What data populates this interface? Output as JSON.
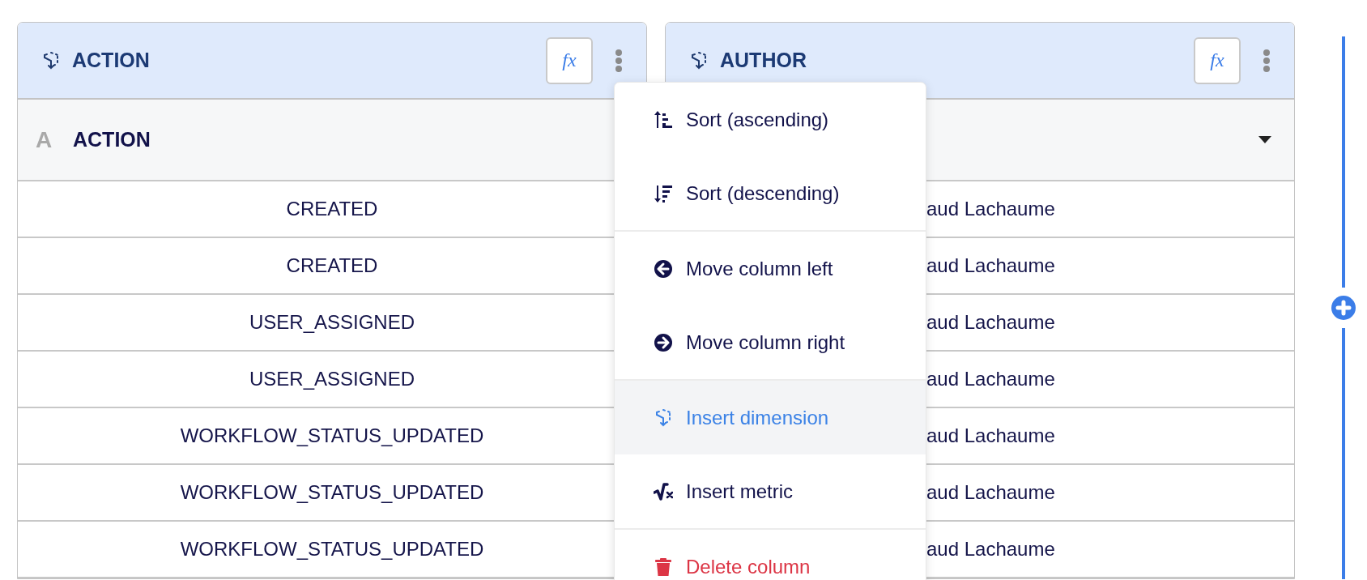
{
  "columns": [
    {
      "header": "ACTION",
      "formula_button": "fx",
      "subheader": {
        "type_glyph": "A",
        "label": "ACTION"
      },
      "rows": [
        "CREATED",
        "CREATED",
        "USER_ASSIGNED",
        "USER_ASSIGNED",
        "WORKFLOW_STATUS_UPDATED",
        "WORKFLOW_STATUS_UPDATED",
        "WORKFLOW_STATUS_UPDATED"
      ]
    },
    {
      "header": "AUTHOR",
      "formula_button": "fx",
      "subheader": {
        "dropdown": true
      },
      "rows": [
        "aud Lachaume",
        "aud Lachaume",
        "aud Lachaume",
        "aud Lachaume",
        "aud Lachaume",
        "aud Lachaume",
        "aud Lachaume"
      ]
    }
  ],
  "menu": {
    "groups": [
      [
        {
          "kind": "sort-ascending",
          "label": "Sort (ascending)",
          "highlighted": false
        },
        {
          "kind": "sort-descending",
          "label": "Sort (descending)",
          "highlighted": false
        }
      ],
      [
        {
          "kind": "move-left",
          "label": "Move column left",
          "highlighted": false
        },
        {
          "kind": "move-right",
          "label": "Move column right",
          "highlighted": false
        }
      ],
      [
        {
          "kind": "insert-dimension",
          "label": "Insert dimension",
          "highlighted": true
        },
        {
          "kind": "insert-metric",
          "label": "Insert metric",
          "highlighted": false
        }
      ],
      [
        {
          "kind": "delete",
          "label": "Delete column",
          "highlighted": false
        }
      ]
    ]
  }
}
